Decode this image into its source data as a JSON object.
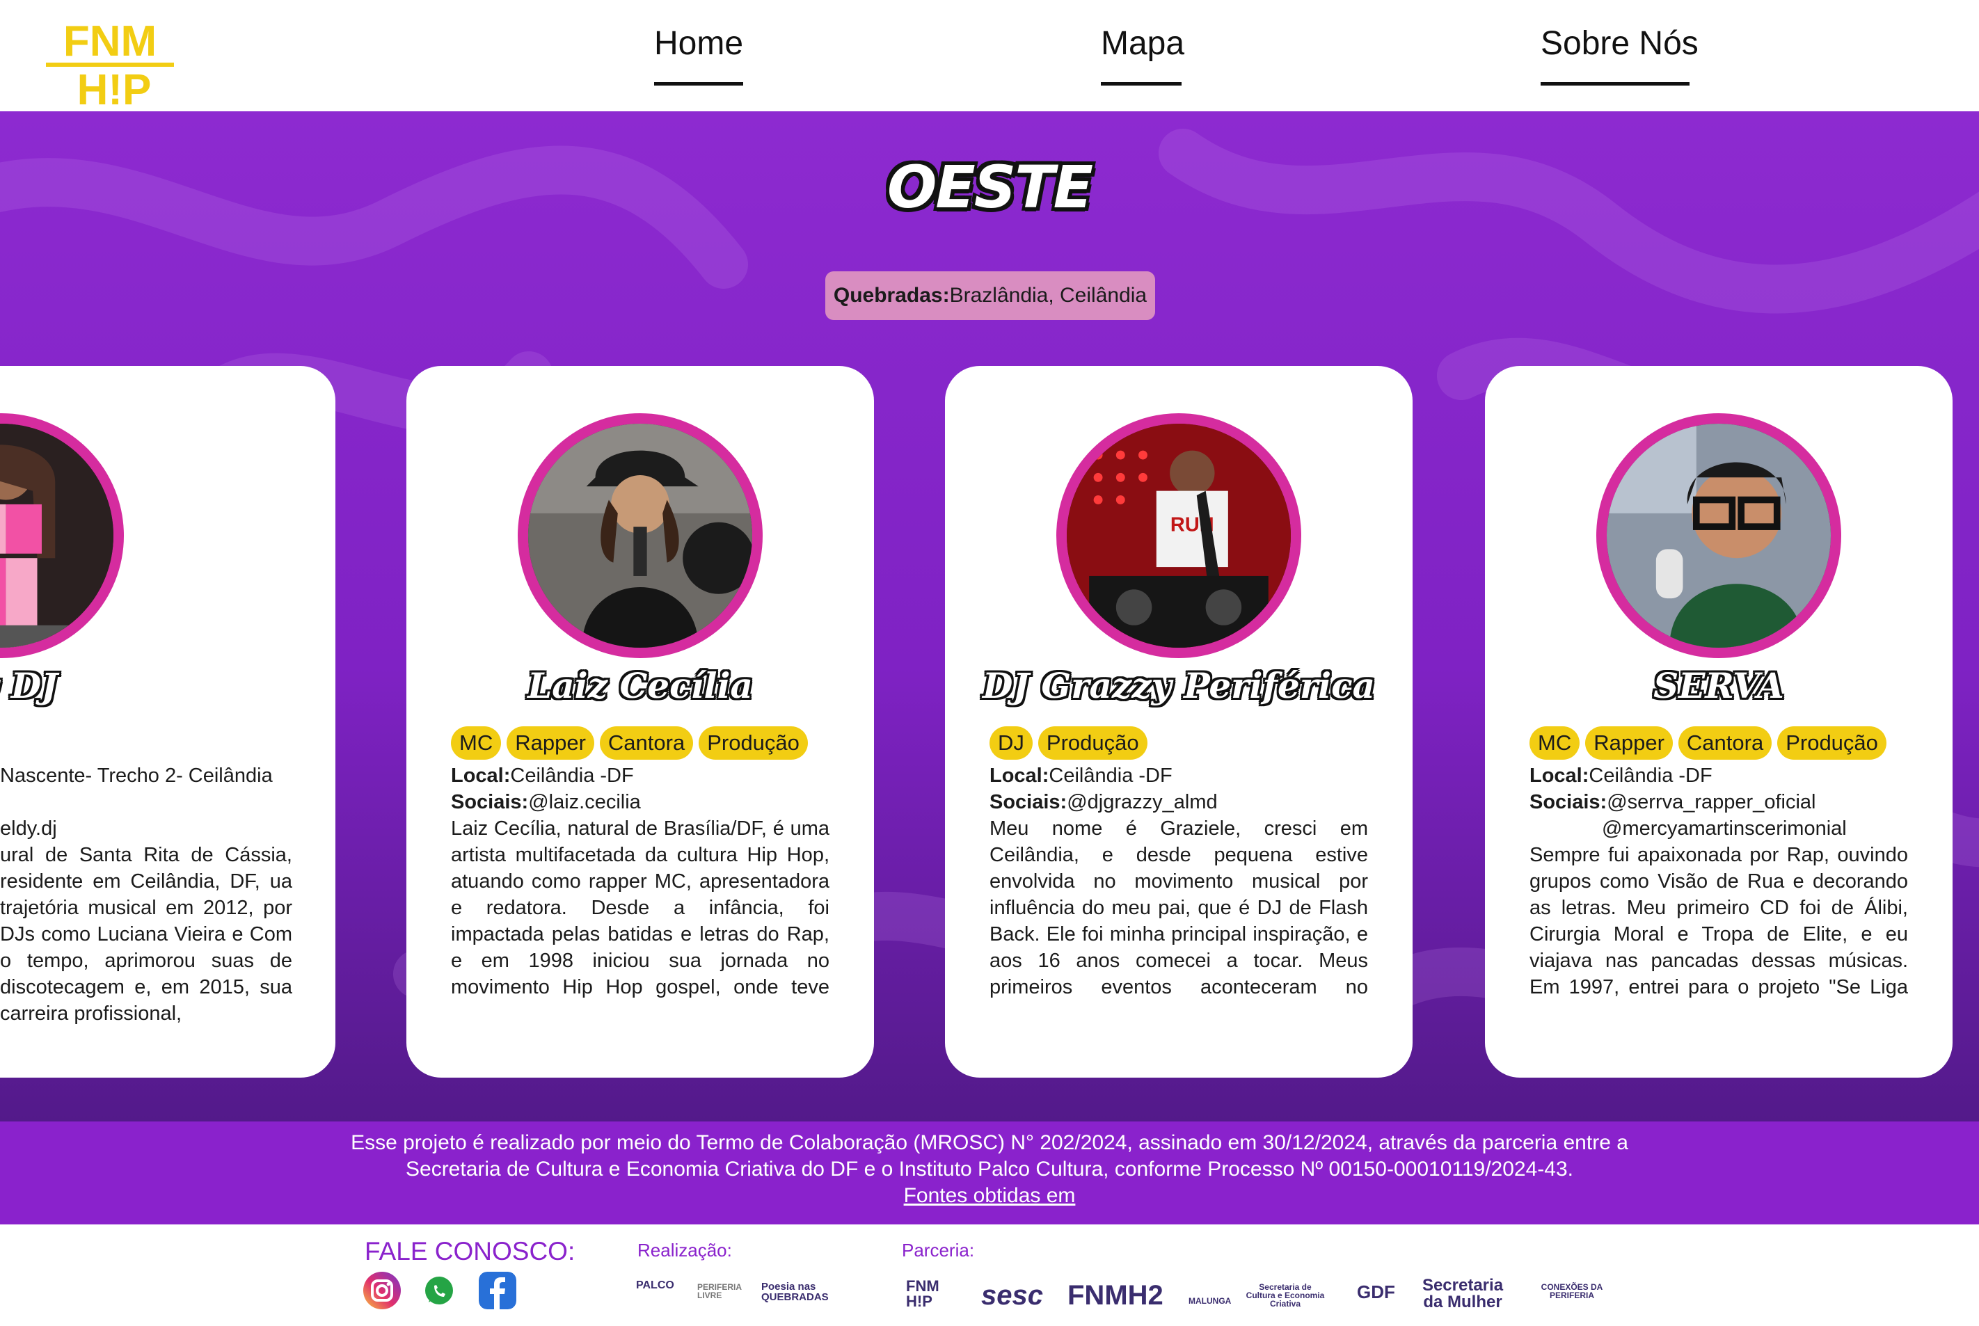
{
  "nav": {
    "home": "Home",
    "mapa": "Mapa",
    "sobre": "Sobre Nós"
  },
  "logo": {
    "line1": "FNM",
    "line2": "H!P"
  },
  "region": {
    "title": "OESTE",
    "quebradas_label": "Quebradas:",
    "quebradas_value": "Brazlândia, Ceilândia"
  },
  "cards": [
    {
      "name": "Eidy DJ",
      "tags": [],
      "local_fragment": "Nascente- Trecho 2- Ceilândia",
      "sociais_fragment": "eldy.dj",
      "bio": "ural de Santa Rita de Cássia, residente em Ceilândia, DF, ua trajetória musical em 2012, por DJs como Luciana Vieira e Com o tempo, aprimorou suas de discotecagem e, em 2015, sua carreira profissional,"
    },
    {
      "name": "Laiz Cecília",
      "tags": [
        "MC",
        "Rapper",
        "Cantora",
        "Produção"
      ],
      "local_label": "Local:",
      "local": "Ceilândia -DF",
      "sociais_label": "Sociais:",
      "sociais": "@laiz.cecilia",
      "bio": "Laiz Cecília, natural de Brasília/DF, é uma artista multifacetada da cultura Hip Hop, atuando como rapper MC, apresentadora e redatora. Desde a infância, foi impactada pelas batidas e letras do Rap, e em 1998 iniciou sua jornada no movimento Hip Hop gospel, onde teve seu primeiro contato com o"
    },
    {
      "name": "DJ Grazzy Periférica",
      "tags": [
        "DJ",
        "Produção"
      ],
      "local_label": "Local:",
      "local": "Ceilândia -DF",
      "sociais_label": "Sociais:",
      "sociais": "@djgrazzy_almd",
      "bio": "Meu nome é Graziele, cresci em Ceilândia, e desde pequena estive envolvida no movimento musical por influência do meu pai, que é DJ de Flash Back. Ele foi minha principal inspiração, e aos 16 anos comecei a tocar. Meus primeiros eventos aconteceram no Ginásio Poliesportivo da Guariroba, e"
    },
    {
      "name": "SERVA",
      "tags": [
        "MC",
        "Rapper",
        "Cantora",
        "Produção"
      ],
      "local_label": "Local:",
      "local": "Ceilândia -DF",
      "sociais_label": "Sociais:",
      "sociais": "@serrva_rapper_oficial",
      "sociais2": "@mercyamartinscerimonial",
      "bio": "Sempre fui apaixonada por Rap, ouvindo grupos como Visão de Rua e decorando as letras. Meu primeiro CD foi de Álibi, Cirurgia Moral e Tropa de Elite, e eu viajava nas pancadas dessas músicas. Em 1997, entrei para o projeto \"Se Liga Galera\", onde fiz uma oficina"
    }
  ],
  "footer": {
    "line1": "Esse projeto é realizado por meio do Termo de Colaboração (MROSC) N° 202/2024, assinado em 30/12/2024, através da parceria entre a",
    "line2": "Secretaria de Cultura e Economia Criativa do DF e o Instituto Palco Cultura, conforme Processo Nº 00150-00010119/2024-43.",
    "sources_link": "Fontes obtidas em"
  },
  "contact": {
    "title": "FALE CONOSCO:",
    "socials": [
      "instagram-icon",
      "whatsapp-icon",
      "facebook-icon"
    ],
    "realizacao_label": "Realização:",
    "realizacao_logos": [
      "PALCO",
      "PERIFERIA LIVRE",
      "Poesia nas QUEBRADAS"
    ],
    "parceria_label": "Parceria:",
    "parceria_logos": [
      "FNM H!P",
      "sesc",
      "FNMH2",
      "MALUNGA",
      "Secretaria de Cultura e Economia Criativa",
      "GDF",
      "Secretaria da Mulher",
      "CONEXÕES DA PERIFERIA"
    ]
  },
  "colors": {
    "purple": "#8a22cc",
    "pink_ring": "#d52c9f",
    "tag_yellow": "#f2cd13",
    "logo_yellow": "#f2cd13"
  }
}
